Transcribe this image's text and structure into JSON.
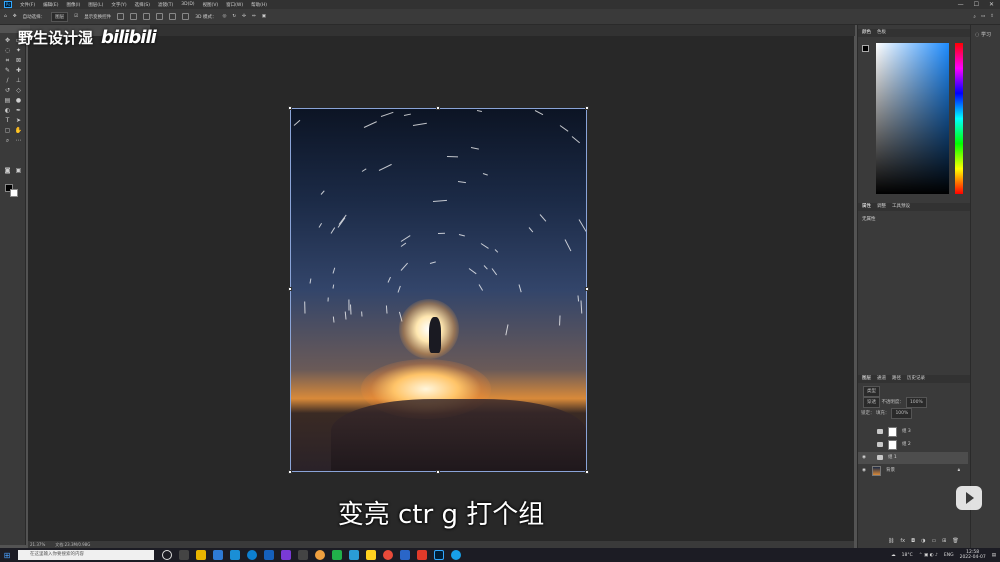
{
  "menubar": {
    "items": [
      "文件(F)",
      "编辑(E)",
      "图像(I)",
      "图层(L)",
      "文字(Y)",
      "选择(S)",
      "滤镜(T)",
      "3D(D)",
      "视图(V)",
      "窗口(W)",
      "帮助(H)"
    ],
    "window_controls": [
      "—",
      "☐",
      "✕"
    ]
  },
  "optionsbar": {
    "auto_select_label": "自动选择：",
    "auto_select_value": "图层",
    "show_transform_label": "显示变换控件",
    "mode_3d_label": "3D 模式："
  },
  "tab": {
    "title": ""
  },
  "watermark": {
    "text": "野生设计湿",
    "logo": "bilibili"
  },
  "caption": {
    "text": "变亮 ctr g 打个组"
  },
  "statusbar": {
    "zoom": "21.37%",
    "doc": "文档:23.3M/0.98G"
  },
  "panels": {
    "color_tabs": [
      "颜色",
      "色板"
    ],
    "props_tabs": [
      "属性",
      "调整",
      "工具预设"
    ],
    "props_label": "无属性",
    "layers_tabs": [
      "图层",
      "通道",
      "路径",
      "历史记录"
    ],
    "kind_label": "类型",
    "blend_mode": "穿透",
    "opacity_label": "不透明度：",
    "opacity_value": "100%",
    "lock_label": "锁定：",
    "fill_label": "填充：",
    "fill_value": "100%",
    "layers": [
      {
        "name": "组 3",
        "visible": false
      },
      {
        "name": "组 2",
        "visible": false
      },
      {
        "name": "组 1",
        "visible": true,
        "selected": true
      },
      {
        "name": "背景",
        "visible": true,
        "locked": true
      }
    ],
    "learn_label": "学习"
  },
  "taskbar": {
    "search_placeholder": "在这里输入你要搜索的内容",
    "weather": "18°C",
    "lang": "ENG",
    "time": "12:58",
    "date": "2022-04-07"
  },
  "colors": {
    "accent": "#31a8ff",
    "selection_frame": "#8aa4d8"
  }
}
